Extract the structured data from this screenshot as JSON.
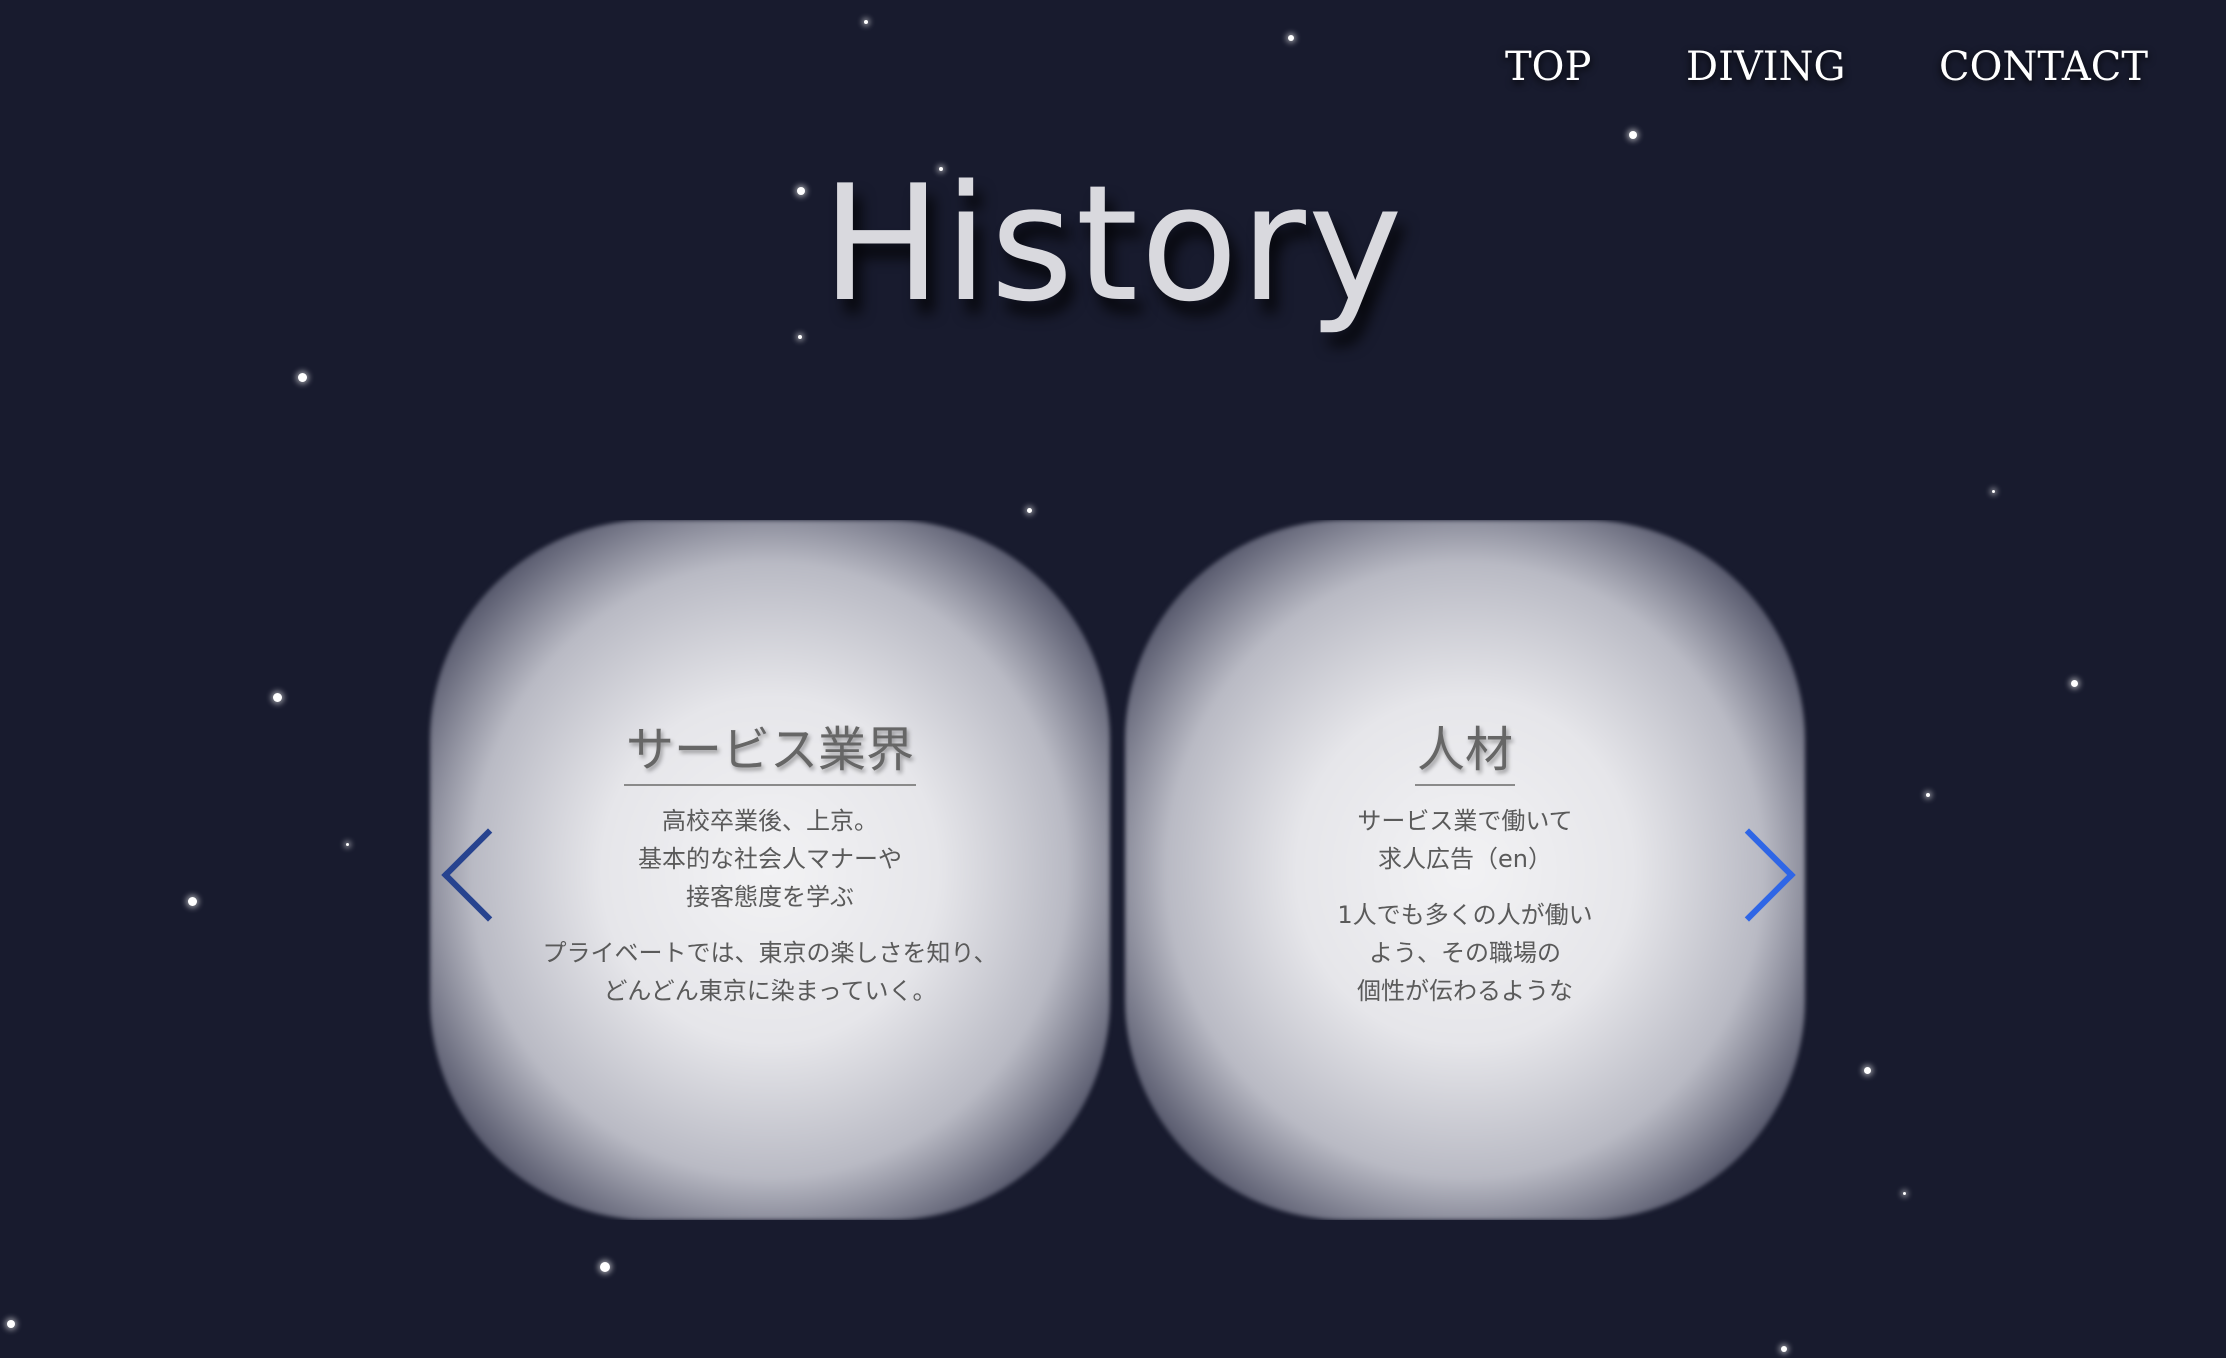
{
  "nav": {
    "items": [
      {
        "label": "TOP"
      },
      {
        "label": "DIVING"
      },
      {
        "label": "CONTACT"
      }
    ]
  },
  "page_title": "History",
  "slider": {
    "cards": [
      {
        "title": "サービス業界",
        "paragraph1": "高校卒業後、上京。\n基本的な社会人マナーや\n接客態度を学ぶ",
        "paragraph2": "プライベートでは、東京の楽しさを知り、\nどんどん東京に染まっていく。"
      },
      {
        "title": "人材",
        "paragraph1": "サービス業で働いて\n求人広告（en）",
        "paragraph2": "1人でも多くの人が働い\nよう、その職場の\n個性が伝わるような"
      }
    ],
    "prev_icon": "chevron-left-icon",
    "next_icon": "chevron-right-icon"
  },
  "colors": {
    "background": "#181b2e",
    "arrow_prev": "#27438f",
    "arrow_next": "#2f66e6"
  }
}
